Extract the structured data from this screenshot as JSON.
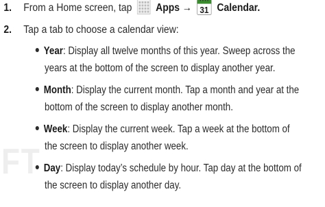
{
  "watermark": "FT",
  "steps": [
    {
      "number": "1.",
      "prefix": "From a Home screen, tap",
      "apps_label": "Apps",
      "arrow": "→",
      "calendar_label": "Calendar.",
      "calendar_icon_day": "31"
    },
    {
      "number": "2.",
      "text": "Tap a tab to choose a calendar view:"
    }
  ],
  "bullets": [
    {
      "term": "Year",
      "line1": ": Display all twelve months of this year. Sweep across the",
      "line2": "years at the bottom of the screen to display another year."
    },
    {
      "term": "Month",
      "line1": ": Display the current month. Tap a month and year at the",
      "line2": "bottom of the screen to display another month."
    },
    {
      "term": "Week",
      "line1": ": Display the current week. Tap a week at the bottom of",
      "line2": "the screen to display another week."
    },
    {
      "term": "Day",
      "line1": ": Display today’s schedule by hour. Tap day at the bottom of",
      "line2": "the screen to display another day."
    }
  ],
  "icons": {
    "apps": "apps-grid-icon",
    "calendar": "calendar-icon"
  },
  "colors": {
    "text": "#2b2b2b",
    "calendar_header": "#3a8a2e",
    "calendar_number": "#1a1a1a",
    "apps_grid": "#b8b8b8",
    "watermark": "#eeeeee"
  }
}
